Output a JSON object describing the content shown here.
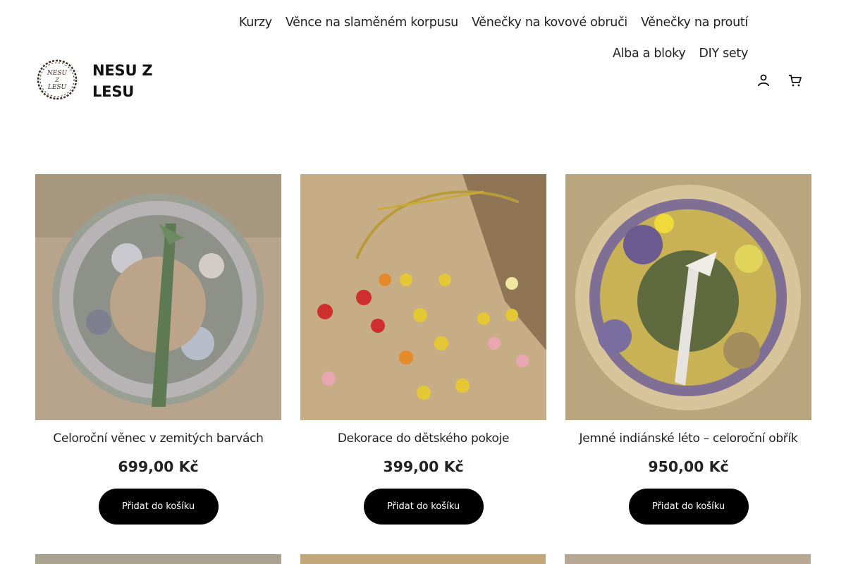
{
  "nav": {
    "items": [
      "Kurzy",
      "Věnce na slaměném korpusu",
      "Věnečky na kovové obruči",
      "Věnečky na proutí",
      "Alba a bloky",
      "DIY sety"
    ]
  },
  "site": {
    "title": "NESU Z LESU",
    "logo_text": [
      "NESU",
      "Z",
      "LESU"
    ]
  },
  "icons": {
    "account": "account-icon",
    "cart": "cart-icon"
  },
  "products": [
    {
      "title": "Celoroční věnec v zemitých barvách",
      "price": "699,00 Kč",
      "button": "Přidat do košíku"
    },
    {
      "title": "Dekorace do dětského pokoje",
      "price": "399,00 Kč",
      "button": "Přidat do košíku"
    },
    {
      "title": "Jemné indiánské léto – celoroční obřík",
      "price": "950,00 Kč",
      "button": "Přidat do košíku"
    }
  ],
  "colors": {
    "button_bg": "#000000",
    "button_text": "#ffffff",
    "text": "#222222"
  }
}
